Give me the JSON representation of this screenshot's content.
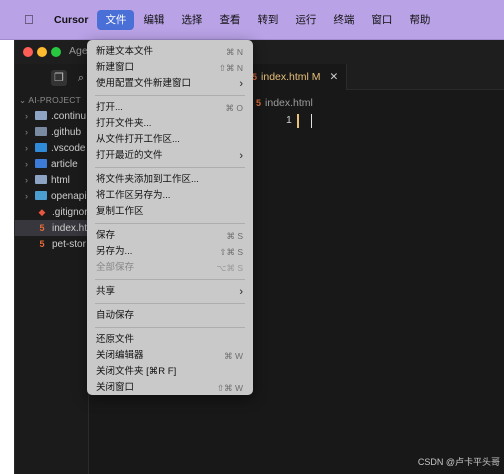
{
  "menubar": {
    "apple_icon": "apple-logo-icon",
    "items": [
      "Cursor",
      "文件",
      "编辑",
      "选择",
      "查看",
      "转到",
      "运行",
      "终端",
      "窗口",
      "帮助"
    ],
    "active_index": 1,
    "bg_color": "#b9a2e6"
  },
  "window": {
    "title": "Agen",
    "explorer": {
      "project": "AI-PROJECT",
      "items": [
        {
          "label": ".continu",
          "kind": "folder"
        },
        {
          "label": ".github",
          "kind": "folder"
        },
        {
          "label": ".vscode",
          "kind": "folder"
        },
        {
          "label": "article",
          "kind": "folder"
        },
        {
          "label": "html",
          "kind": "folder"
        },
        {
          "label": "openapi",
          "kind": "folder"
        },
        {
          "label": ".gitignore",
          "kind": "file"
        },
        {
          "label": "index.ht",
          "kind": "file"
        },
        {
          "label": "pet-stor",
          "kind": "file"
        }
      ]
    },
    "editor": {
      "tab_label": "index.html",
      "tab_modified": "M",
      "tab_close": "✕",
      "breadcrumb": "index.html",
      "line_number": "1",
      "html_icon_text": "5"
    }
  },
  "file_menu": {
    "groups": [
      [
        {
          "label": "新建文本文件",
          "shortcut": "⌘ N"
        },
        {
          "label": "新建窗口",
          "shortcut": "⇧⌘ N"
        },
        {
          "label": "使用配置文件新建窗口",
          "submenu": true
        }
      ],
      [
        {
          "label": "打开...",
          "shortcut": "⌘ O"
        },
        {
          "label": "打开文件夹..."
        },
        {
          "label": "从文件打开工作区..."
        },
        {
          "label": "打开最近的文件",
          "submenu": true
        }
      ],
      [
        {
          "label": "将文件夹添加到工作区..."
        },
        {
          "label": "将工作区另存为..."
        },
        {
          "label": "复制工作区"
        }
      ],
      [
        {
          "label": "保存",
          "shortcut": "⌘ S"
        },
        {
          "label": "另存为...",
          "shortcut": "⇧⌘ S"
        },
        {
          "label": "全部保存",
          "shortcut": "⌥⌘ S",
          "disabled": true
        }
      ],
      [
        {
          "label": "共享",
          "submenu": true
        }
      ],
      [
        {
          "label": "自动保存"
        }
      ],
      [
        {
          "label": "还原文件"
        },
        {
          "label": "关闭编辑器",
          "shortcut": "⌘ W"
        },
        {
          "label": "关闭文件夹 [⌘R F]"
        },
        {
          "label": "关闭窗口",
          "shortcut": "⇧⌘ W"
        }
      ]
    ],
    "submenu_arrow": "›"
  },
  "watermark": "CSDN @卢卡平头哥"
}
